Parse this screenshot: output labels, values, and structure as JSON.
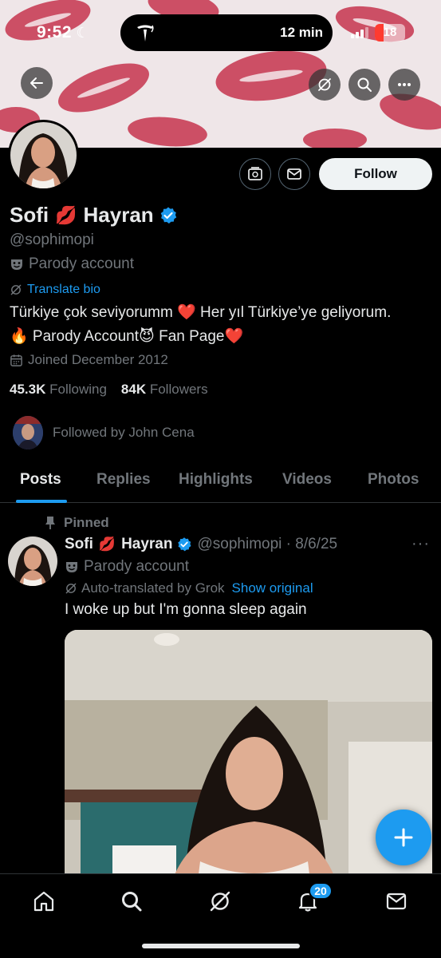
{
  "status_bar": {
    "time": "9:52",
    "eta": "12 min",
    "battery": "18"
  },
  "profile": {
    "name_first": "Sofi",
    "name_emoji": "💋",
    "name_last": "Hayran",
    "handle": "@sophimopi",
    "parody_label": "Parody account",
    "translate_bio": "Translate bio",
    "bio_line1": "Türkiye çok seviyorumm ❤️ Her yıl Türkiye’ye geliyorum.",
    "bio_line2": "🔥 Parody Account😈 Fan Page❤️",
    "joined": "Joined December 2012",
    "following_count": "45.3K",
    "following_label": "Following",
    "followers_count": "84K",
    "followers_label": "Followers",
    "followed_by": "Followed by John Cena",
    "follow_button": "Follow"
  },
  "tabs": [
    "Posts",
    "Replies",
    "Highlights",
    "Videos",
    "Photos"
  ],
  "post": {
    "pinned": "Pinned",
    "name_first": "Sofi",
    "name_emoji": "💋",
    "name_last": "Hayran",
    "handle_date": "@sophimopi · 8/6/25",
    "parody_label": "Parody account",
    "auto_translated": "Auto-translated by Grok",
    "show_original": "Show original",
    "text": "I woke up but I'm gonna sleep again",
    "more": "···"
  },
  "nav": {
    "notifications_badge": "20"
  },
  "colors": {
    "accent": "#1d9bf0",
    "verified": "#1d9bf0",
    "background": "#000000"
  }
}
